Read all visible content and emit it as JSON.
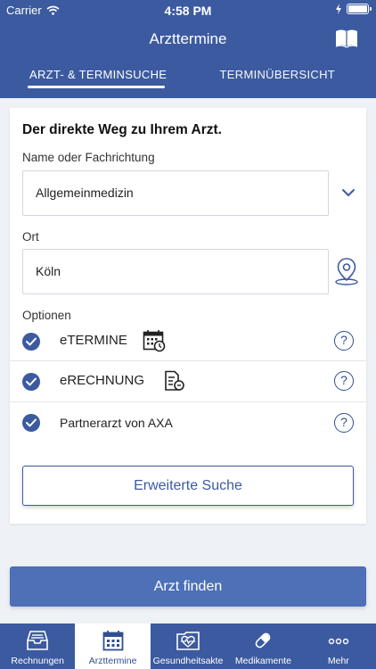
{
  "status_bar": {
    "carrier": "Carrier",
    "time": "4:58 PM"
  },
  "header": {
    "title": "Arzttermine",
    "book_icon": "book-icon"
  },
  "tabs": [
    {
      "label": "ARZT- & TERMINSUCHE",
      "active": true
    },
    {
      "label": "TERMINÜBERSICHT",
      "active": false
    }
  ],
  "card": {
    "heading": "Der direkte Weg zu Ihrem Arzt.",
    "name_label": "Name oder Fachrichtung",
    "name_value": "Allgemeinmedizin",
    "ort_label": "Ort",
    "ort_value": "Köln",
    "options_label": "Optionen",
    "options": [
      {
        "label": "eTERMINE",
        "checked": true,
        "icon": "calendar-clock-icon"
      },
      {
        "label": "eRECHNUNG",
        "checked": true,
        "icon": "invoice-icon"
      },
      {
        "label": "Partnerarzt von AXA",
        "checked": true,
        "icon": ""
      }
    ],
    "help_glyph": "?",
    "advanced_button": "Erweiterte Suche"
  },
  "find_button": "Arzt finden",
  "tabbar": [
    {
      "label": "Rechnungen",
      "icon": "inbox-icon",
      "active": false
    },
    {
      "label": "Arzttermine",
      "icon": "calendar-icon",
      "active": true
    },
    {
      "label": "Gesundheitsakte",
      "icon": "health-folder-icon",
      "active": false
    },
    {
      "label": "Medikamente",
      "icon": "pill-icon",
      "active": false
    },
    {
      "label": "Mehr",
      "icon": "more-icon",
      "active": false
    }
  ],
  "colors": {
    "primary": "#3c5a9f",
    "button": "#4d70b7",
    "background": "#eef1f6"
  }
}
